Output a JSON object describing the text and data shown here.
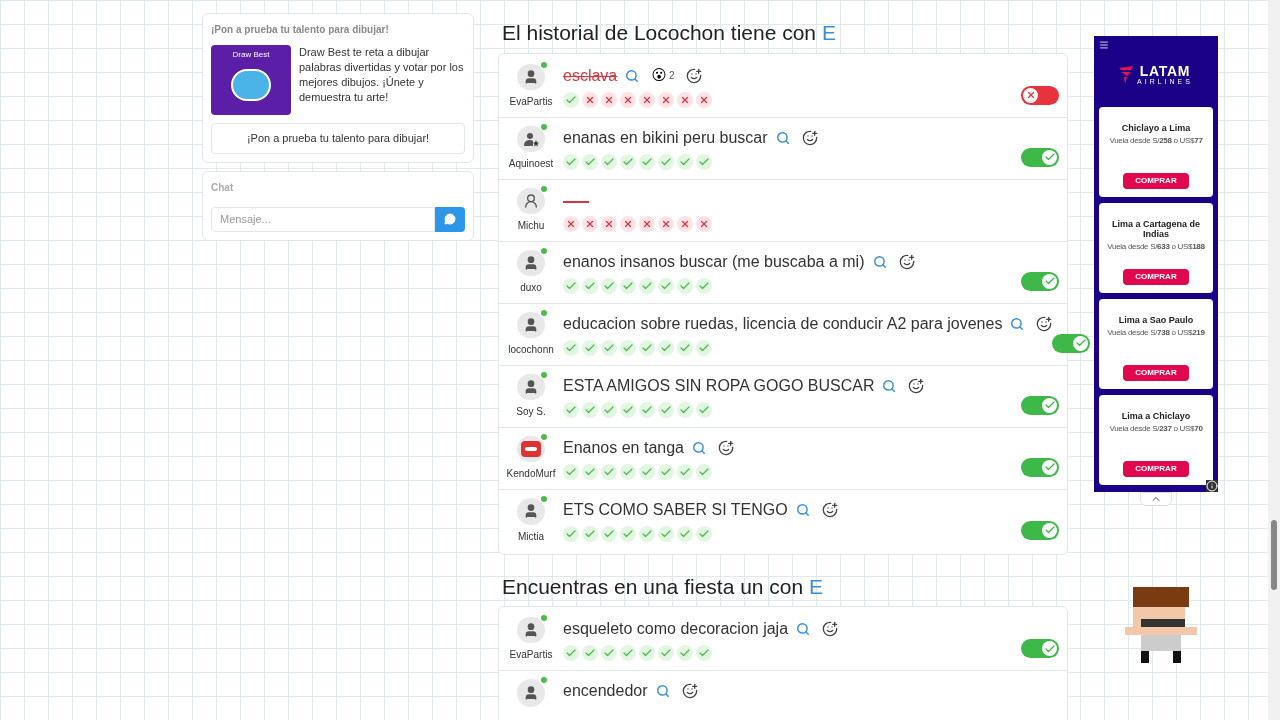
{
  "promo": {
    "heading": "¡Pon a prueba tu talento para dibujar!",
    "image_title": "Draw Best",
    "description": "Draw Best te reta a dibujar palabras divertidas y votar por los mejores dibujos. ¡Únete y demuestra tu arte!",
    "button": "¡Pon a prueba tu talento para dibujar!"
  },
  "chat": {
    "heading": "Chat",
    "placeholder": "Mensaje..."
  },
  "sections": [
    {
      "title": "El historial de Locochon tiene con",
      "letter": "E",
      "rows": [
        {
          "user": "EvaPartis",
          "kind": "person",
          "word": "esclava",
          "struck": true,
          "reaction": {
            "emoji": "😮",
            "count": "2"
          },
          "votes": [
            true,
            false,
            false,
            false,
            false,
            false,
            false,
            false
          ],
          "approved": false
        },
        {
          "user": "Aquinoest",
          "kind": "star",
          "word": "enanas en bikini peru buscar",
          "struck": false,
          "votes": [
            true,
            true,
            true,
            true,
            true,
            true,
            true,
            true
          ],
          "approved": true
        },
        {
          "user": "Michu",
          "kind": "outline",
          "struck": true,
          "votes": [
            false,
            false,
            false,
            false,
            false,
            false,
            false,
            false
          ]
        },
        {
          "user": "duxo",
          "kind": "person",
          "word": "enanos insanos buscar (me buscaba a mi)",
          "struck": false,
          "votes": [
            true,
            true,
            true,
            true,
            true,
            true,
            true,
            true
          ],
          "approved": true
        },
        {
          "user": "locochonn",
          "kind": "person",
          "word": "educacion sobre ruedas, licencia de conducir A2 para jovenes",
          "struck": false,
          "votes": [
            true,
            true,
            true,
            true,
            true,
            true,
            true,
            true
          ],
          "approved": true
        },
        {
          "user": "Soy S.",
          "kind": "person",
          "word": "ESTA AMIGOS SIN ROPA GOGO BUSCAR",
          "struck": false,
          "votes": [
            true,
            true,
            true,
            true,
            true,
            true,
            true,
            true
          ],
          "approved": true
        },
        {
          "user": "KendoMurf",
          "kind": "stop",
          "word": "Enanos en tanga",
          "struck": false,
          "votes": [
            true,
            true,
            true,
            true,
            true,
            true,
            true,
            true
          ],
          "approved": true
        },
        {
          "user": "Mictia",
          "kind": "person",
          "word": "ETS COMO SABER SI TENGO",
          "struck": false,
          "votes": [
            true,
            true,
            true,
            true,
            true,
            true,
            true,
            true
          ],
          "approved": true
        }
      ]
    },
    {
      "title": "Encuentras en una fiesta un con",
      "letter": "E",
      "rows": [
        {
          "user": "EvaPartis",
          "kind": "person",
          "word": "esqueleto como decoracion jaja",
          "struck": false,
          "votes": [
            true,
            true,
            true,
            true,
            true,
            true,
            true,
            true
          ],
          "approved": true
        },
        {
          "kind": "person",
          "word": "encendedor",
          "struck": false
        }
      ]
    }
  ],
  "ad": {
    "brand": "LATAM",
    "brand_sub": "AIRLINES",
    "offers": [
      {
        "route": "Chiclayo a Lima",
        "price": "Vuela desde S/**258** o US$**77**",
        "button": "COMPRAR"
      },
      {
        "route": "Lima a Cartagena de Indias",
        "price": "Vuela desde S/**633** o US$**188**",
        "button": "COMPRAR"
      },
      {
        "route": "Lima a Sao Paulo",
        "price": "Vuela desde S/**738** o US$**219**",
        "button": "COMPRAR"
      },
      {
        "route": "Lima a Chiclayo",
        "price": "Vuela desde S/**237** o US$**70**",
        "button": "COMPRAR"
      }
    ]
  }
}
